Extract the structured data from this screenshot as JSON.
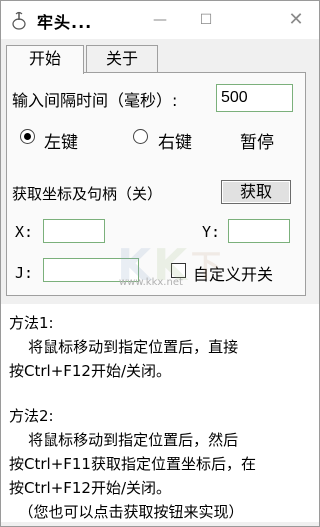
{
  "window": {
    "title": "牢头...",
    "minimize_glyph": "—",
    "maximize_glyph": "☐",
    "close_glyph": "✕"
  },
  "tabs": [
    {
      "label": "开始",
      "active": true
    },
    {
      "label": "关于",
      "active": false
    }
  ],
  "interval": {
    "label": "输入间隔时间（毫秒）:",
    "value": "500"
  },
  "mouse": {
    "left_label": "左键",
    "left_selected": true,
    "right_label": "右键",
    "right_selected": false,
    "pause_label": "暂停"
  },
  "capture": {
    "label": "获取坐标及句柄（关）",
    "button_label": "获取",
    "x_label": "X:",
    "x_value": "",
    "y_label": "Y:",
    "y_value": "",
    "j_label": "J:",
    "j_value": "",
    "custom_switch_label": "自定义开关",
    "custom_switch_checked": false
  },
  "help": {
    "lines": [
      "方法1:",
      "    将鼠标移动到指定位置后，直接",
      "按Ctrl+F12开始/关闭。",
      "",
      "方法2:",
      "    将鼠标移动到指定位置后，然后",
      "按Ctrl+F11获取指定位置坐标后，在",
      "按Ctrl+F12开始/关闭。",
      "  （您也可以点击获取按钮来实现）"
    ]
  },
  "watermark": {
    "text": "www.kkx.net",
    "icon": "kkx-logo-icon"
  },
  "colors": {
    "input_border": "#7bb07b",
    "window_bg": "#f0f0f0",
    "panel_bg": "#fafafa"
  }
}
